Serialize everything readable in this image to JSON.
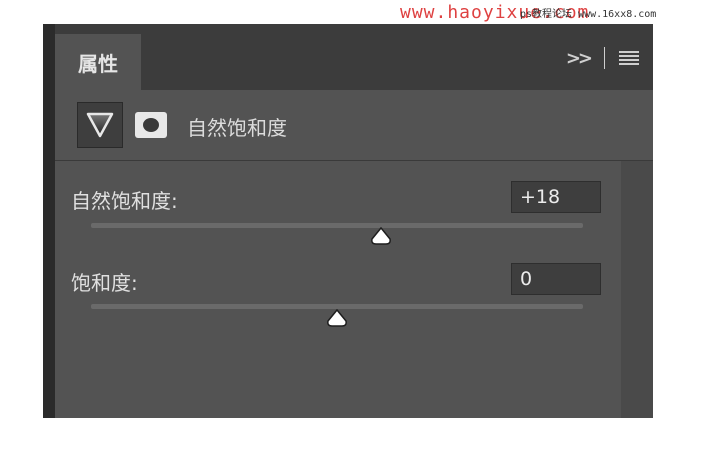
{
  "watermark": {
    "text": "www.haoyixue.com",
    "sub": "ps教程论坛 www.16xx8.com"
  },
  "panel": {
    "tab_label": "属性",
    "header_title": "自然饱和度",
    "icons": {
      "adjustment": "vibrance-triangle-icon",
      "mask": "layer-mask-icon",
      "expand": "expand-panel-icon",
      "menu": "panel-menu-icon"
    }
  },
  "controls": {
    "vibrance": {
      "label": "自然饱和度:",
      "value_text": "+18",
      "value": 18,
      "min": -100,
      "max": 100
    },
    "saturation": {
      "label": "饱和度:",
      "value_text": "0",
      "value": 0,
      "min": -100,
      "max": 100
    }
  },
  "colors": {
    "panel_bg": "#535353",
    "tab_bar": "#3c3c3c"
  }
}
